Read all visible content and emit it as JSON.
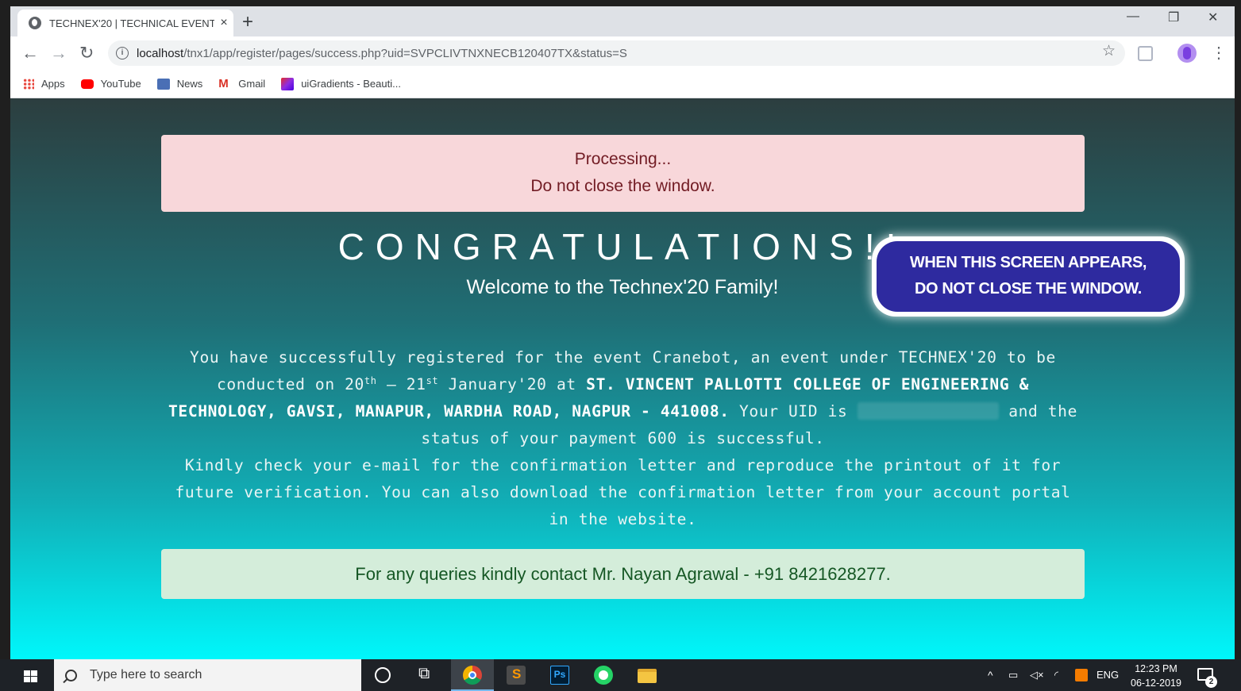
{
  "browser": {
    "tab_title": "TECHNEX'20 | TECHNICAL EVENT",
    "tab_close": "×",
    "new_tab": "+",
    "url_host": "localhost",
    "url_path": "/tnx1/app/register/pages/success.php?uid=SVPCLIVTNXNECB120407TX&status=S",
    "window_controls": {
      "minimize": "—",
      "restore": "❐",
      "close": "✕"
    },
    "nav": {
      "back": "←",
      "forward": "→",
      "reload": "↻"
    },
    "bookmarks": [
      {
        "label": "Apps",
        "icon": "apps-grid-icon",
        "color": "#e8453c"
      },
      {
        "label": "YouTube",
        "icon": "youtube-icon",
        "color": "#ff0000"
      },
      {
        "label": "News",
        "icon": "news-icon",
        "color": "#4a6fb5"
      },
      {
        "label": "Gmail",
        "icon": "gmail-icon",
        "color": "#d93025"
      },
      {
        "label": "uiGradients - Beauti...",
        "icon": "uigradients-icon",
        "color": "#8e2de2"
      }
    ]
  },
  "page": {
    "processing_line1": "Processing...",
    "processing_line2": "Do not close the window.",
    "heading": "CONGRATULATIONS!!",
    "subheading": "Welcome to the Technex'20 Family!",
    "body": {
      "p1_start": "You have successfully registered for the event Cranebot, an event under TECHNEX'20 to be conducted on 20",
      "sup1": "th",
      "dash": " – 21",
      "sup2": "st",
      "p1_mid": " January'20 at ",
      "venue": "ST. VINCENT PALLOTTI COLLEGE OF ENGINEERING & TECHNOLOGY, GAVSI, MANAPUR, WARDHA ROAD, NAGPUR - 441008.",
      "p1_uid": " Your UID is ",
      "p1_end": " and the status of your payment 600 is successful.",
      "p2": "Kindly check your e-mail for the confirmation letter and reproduce the printout of it for future verification. You can also download the confirmation letter from your account portal in the website."
    },
    "contact": "For any queries kindly contact Mr. Nayan Agrawal - +91 8421628277.",
    "callout_line1": "WHEN THIS SCREEN APPEARS,",
    "callout_line2": "DO NOT CLOSE THE WINDOW."
  },
  "taskbar": {
    "search_placeholder": "Type here to search",
    "language": "ENG",
    "time": "12:23 PM",
    "date": "06-12-2019",
    "notifications_count": "2",
    "ps_label": "Ps"
  },
  "colors": {
    "processing_bg": "#f8d7da",
    "contact_bg": "#d4edda",
    "callout_bg": "#2e2a9f",
    "gradient_top": "#2c3e3f",
    "gradient_bottom": "#00f7fb"
  }
}
